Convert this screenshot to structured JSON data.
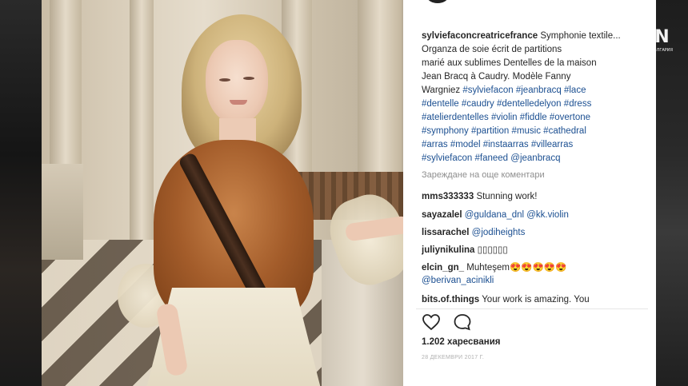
{
  "broadcast": {
    "logo_text": "БЪЛГАРИЯ",
    "logo_mark": "N"
  },
  "post": {
    "caption": {
      "username": "sylviefaconcreatricefrance",
      "text_lines": [
        "Symphonie",
        "textile... Organza de soie écrit de partitions",
        "marié aux sublimes Dentelles de la maison",
        "Jean Bracq à Caudry. Modèle Fanny",
        "Wargniez"
      ],
      "hashtags_lines": [
        [
          "#sylviefacon",
          "#jeanbracq",
          "#lace"
        ],
        [
          "#dentelle",
          "#caudry",
          "#dentelledelyon",
          "#dress"
        ],
        [
          "#atelierdentelles",
          "#violin",
          "#fiddle",
          "#overtone"
        ],
        [
          "#symphony",
          "#partition",
          "#music",
          "#cathedral"
        ],
        [
          "#arras",
          "#model",
          "#instaarras",
          "#villearras"
        ],
        [
          "#sylviefacon",
          "#faneed",
          "@jeanbracq"
        ]
      ]
    },
    "load_more": "Зареждане на още коментари",
    "comments": [
      {
        "user": "mms333333",
        "text": "Stunning work!",
        "mentions": ""
      },
      {
        "user": "sayazalel",
        "text": "",
        "mentions": "@guldana_dnl @kk.violin"
      },
      {
        "user": "lissarachel",
        "text": "",
        "mentions": "@jodiheights"
      },
      {
        "user": "juliynikulina",
        "text": "▯▯▯▯▯▯",
        "mentions": ""
      },
      {
        "user": "elcin_gn_",
        "text": "Muhteşem😍😍😍😍😍",
        "mentions": ""
      },
      {
        "user": "",
        "text": "",
        "mentions": "@berivan_acinikli"
      },
      {
        "user": "bits.of.things",
        "text": "Your work is amazing. You",
        "mentions": ""
      }
    ],
    "actions": {
      "like_icon": "heart-icon",
      "comment_icon": "comment-bubble-icon"
    },
    "likes": "1.202 харесвания",
    "date": "28 ДЕКЕМВРИ 2017 Г."
  }
}
